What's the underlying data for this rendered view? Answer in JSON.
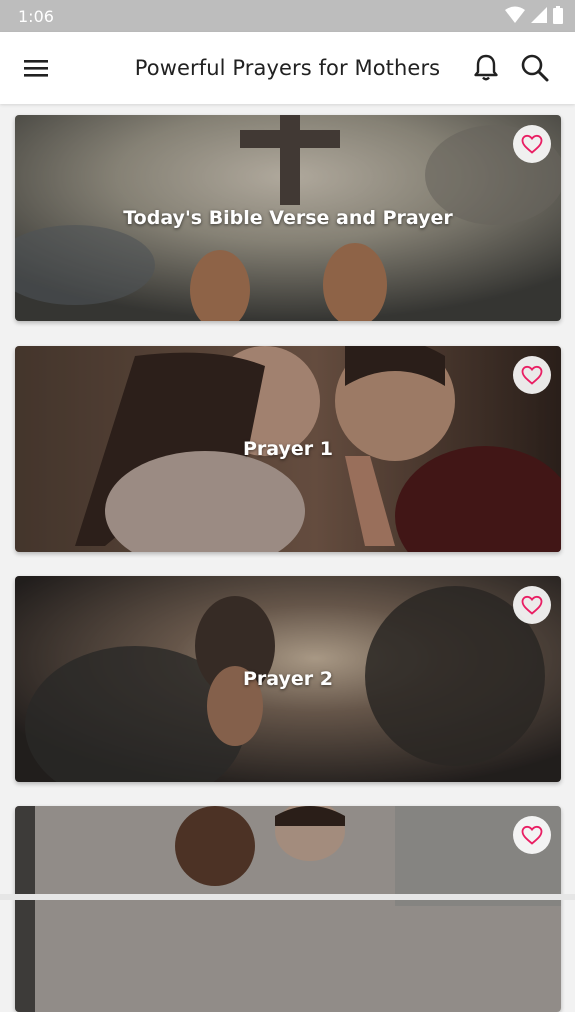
{
  "status_bar": {
    "time": "1:06"
  },
  "app_bar": {
    "title": "Powerful Prayers for Mothers"
  },
  "cards": [
    {
      "label": "Today's Bible Verse and Prayer"
    },
    {
      "label": "Prayer 1"
    },
    {
      "label": "Prayer 2"
    },
    {
      "label": ""
    }
  ],
  "colors": {
    "accent": "#e91e63",
    "app_bar_bg": "#ffffff",
    "status_bar_bg": "#bdbdbd"
  },
  "icons": [
    "menu-icon",
    "bell-icon",
    "search-icon",
    "heart-outline-icon",
    "wifi-icon",
    "signal-icon",
    "battery-icon"
  ]
}
